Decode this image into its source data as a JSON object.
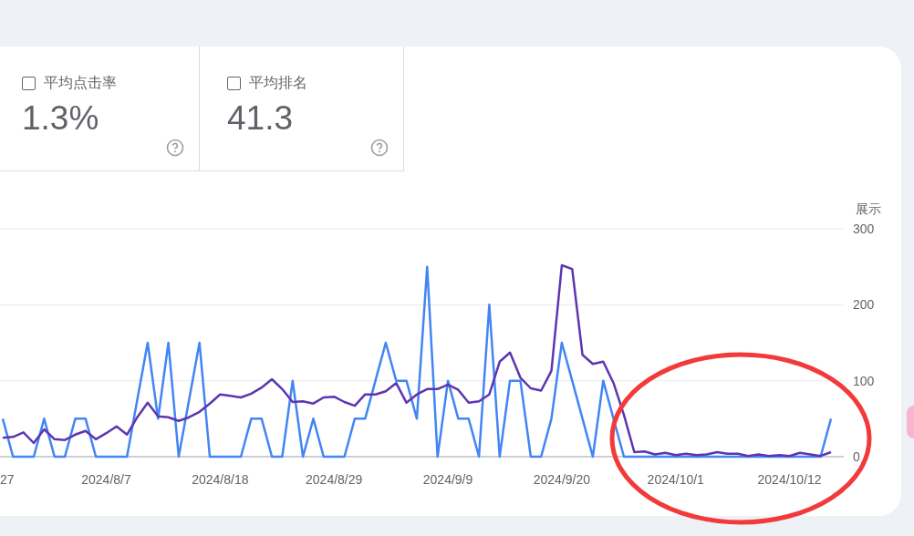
{
  "metrics": [
    {
      "label": "平均点击率",
      "value": "1.3%",
      "checked": false
    },
    {
      "label": "平均排名",
      "value": "41.3",
      "checked": false
    }
  ],
  "chart_data": {
    "type": "line",
    "ylabel": "展示",
    "ylim": [
      0,
      300
    ],
    "yticks": [
      0,
      100,
      200,
      300
    ],
    "categories": [
      "27",
      null,
      null,
      null,
      null,
      null,
      null,
      null,
      null,
      null,
      "2024/8/7",
      null,
      null,
      null,
      null,
      null,
      null,
      null,
      null,
      null,
      null,
      "2024/8/18",
      null,
      null,
      null,
      null,
      null,
      null,
      null,
      null,
      null,
      null,
      "2024/8/29",
      null,
      null,
      null,
      null,
      null,
      null,
      null,
      null,
      null,
      null,
      "2024/9/9",
      null,
      null,
      null,
      null,
      null,
      null,
      null,
      null,
      null,
      null,
      "2024/9/20",
      null,
      null,
      null,
      null,
      null,
      null,
      null,
      null,
      null,
      null,
      "2024/10/1",
      null,
      null,
      null,
      null,
      null,
      null,
      null,
      null,
      null,
      null,
      "2024/10/12",
      null,
      null,
      null,
      null
    ],
    "series": [
      {
        "color": "#4285f4",
        "values": [
          50,
          0,
          0,
          0,
          50,
          0,
          0,
          50,
          50,
          0,
          0,
          0,
          0,
          75,
          150,
          50,
          150,
          0,
          75,
          150,
          0,
          0,
          0,
          0,
          50,
          50,
          0,
          0,
          100,
          0,
          50,
          0,
          0,
          0,
          50,
          50,
          100,
          150,
          100,
          100,
          50,
          250,
          0,
          100,
          50,
          50,
          0,
          200,
          0,
          100,
          100,
          0,
          0,
          50,
          150,
          100,
          50,
          0,
          100,
          50,
          0,
          0,
          0,
          0,
          0,
          0,
          0,
          0,
          0,
          0,
          0,
          0,
          0,
          0,
          0,
          0,
          0,
          0,
          0,
          0,
          50
        ]
      },
      {
        "color": "#5e35b1",
        "values": [
          25,
          26,
          32,
          18,
          36,
          23,
          22,
          29,
          34,
          23,
          31,
          40,
          29,
          52,
          71,
          53,
          52,
          47,
          52,
          59,
          70,
          82,
          80,
          78,
          83,
          91,
          102,
          89,
          72,
          73,
          70,
          78,
          79,
          72,
          67,
          82,
          82,
          86,
          97,
          71,
          82,
          89,
          89,
          95,
          88,
          71,
          73,
          82,
          125,
          137,
          104,
          90,
          87,
          113,
          252,
          247,
          134,
          122,
          125,
          97,
          55,
          6,
          7,
          3,
          5,
          2,
          4,
          2,
          3,
          6,
          4,
          4,
          1,
          3,
          1,
          2,
          1,
          5,
          3,
          1,
          6
        ]
      }
    ]
  },
  "markup": {
    "kind": "ellipse",
    "color": "#f23a3a"
  }
}
